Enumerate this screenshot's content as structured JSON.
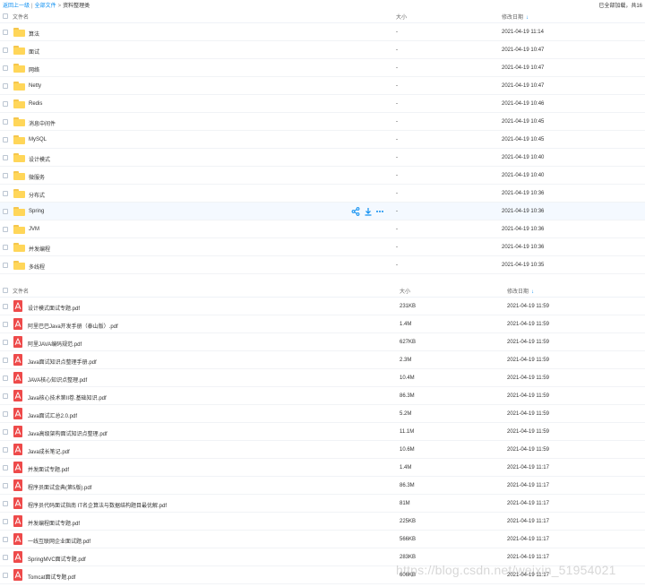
{
  "breadcrumb": {
    "back": "返回上一级",
    "all_files": "全部文件",
    "current": "资料整理类",
    "separator_1": "|",
    "separator_2": ">"
  },
  "status": {
    "loaded_text": "已全部加载，共16"
  },
  "columns": {
    "name": "文件名",
    "size": "大小",
    "date": "修改日期",
    "sort_arrow": "↓"
  },
  "folders": [
    {
      "name": "算法",
      "size": "-",
      "date": "2021-04-19 11:14"
    },
    {
      "name": "面试",
      "size": "-",
      "date": "2021-04-19 10:47"
    },
    {
      "name": "网络",
      "size": "-",
      "date": "2021-04-19 10:47"
    },
    {
      "name": "Netty",
      "size": "-",
      "date": "2021-04-19 10:47"
    },
    {
      "name": "Redis",
      "size": "-",
      "date": "2021-04-19 10:46"
    },
    {
      "name": "消息中间件",
      "size": "-",
      "date": "2021-04-19 10:45"
    },
    {
      "name": "MySQL",
      "size": "-",
      "date": "2021-04-19 10:45"
    },
    {
      "name": "设计模式",
      "size": "-",
      "date": "2021-04-19 10:40"
    },
    {
      "name": "微服务",
      "size": "-",
      "date": "2021-04-19 10:40"
    },
    {
      "name": "分布式",
      "size": "-",
      "date": "2021-04-19 10:36"
    },
    {
      "name": "Spring",
      "size": "-",
      "date": "2021-04-19 10:36"
    },
    {
      "name": "JVM",
      "size": "-",
      "date": "2021-04-19 10:36"
    },
    {
      "name": "并发编程",
      "size": "-",
      "date": "2021-04-19 10:36"
    },
    {
      "name": "多线程",
      "size": "-",
      "date": "2021-04-19 10:35"
    }
  ],
  "hover_row_index": 10,
  "row_actions": [
    "share-icon",
    "download-icon",
    "more-icon"
  ],
  "files": [
    {
      "name": "设计模式面试专题.pdf",
      "size": "231KB",
      "date": "2021-04-19 11:59"
    },
    {
      "name": "阿里巴巴Java开发手册（泰山版）.pdf",
      "size": "1.4M",
      "date": "2021-04-19 11:59"
    },
    {
      "name": "阿里JAVA编码规范.pdf",
      "size": "627KB",
      "date": "2021-04-19 11:59"
    },
    {
      "name": "Java面试知识点整理手册.pdf",
      "size": "2.3M",
      "date": "2021-04-19 11:59"
    },
    {
      "name": "JAVA核心知识点整理.pdf",
      "size": "10.4M",
      "date": "2021-04-19 11:59"
    },
    {
      "name": "Java核心技术第II卷.基础知识.pdf",
      "size": "86.3M",
      "date": "2021-04-19 11:59"
    },
    {
      "name": "Java面试汇总2.0.pdf",
      "size": "5.2M",
      "date": "2021-04-19 11:59"
    },
    {
      "name": "Java高级架构面试知识点整理.pdf",
      "size": "11.1M",
      "date": "2021-04-19 11:59"
    },
    {
      "name": "Java成长笔记.pdf",
      "size": "10.6M",
      "date": "2021-04-19 11:59"
    },
    {
      "name": "并发面试专题.pdf",
      "size": "1.4M",
      "date": "2021-04-19 11:17"
    },
    {
      "name": "程序员面试金典(第5版).pdf",
      "size": "86.3M",
      "date": "2021-04-19 11:17"
    },
    {
      "name": "程序员代码面试指南 IT名企算法与数据结构题目最优解.pdf",
      "size": "81M",
      "date": "2021-04-19 11:17"
    },
    {
      "name": "并发编程面试专题.pdf",
      "size": "225KB",
      "date": "2021-04-19 11:17"
    },
    {
      "name": "一线互联网企业面试题.pdf",
      "size": "566KB",
      "date": "2021-04-19 11:17"
    },
    {
      "name": "SpringMVC面试专题.pdf",
      "size": "283KB",
      "date": "2021-04-19 11:17"
    },
    {
      "name": "Tomcat面试专题.pdf",
      "size": "606KB",
      "date": "2021-04-19 11:17"
    }
  ],
  "watermark": "https://blog.csdn.net/weixin_51954021",
  "colors": {
    "accent": "#0b8ef1",
    "folder": "#ffd659",
    "pdf": "#ee4a4a"
  }
}
